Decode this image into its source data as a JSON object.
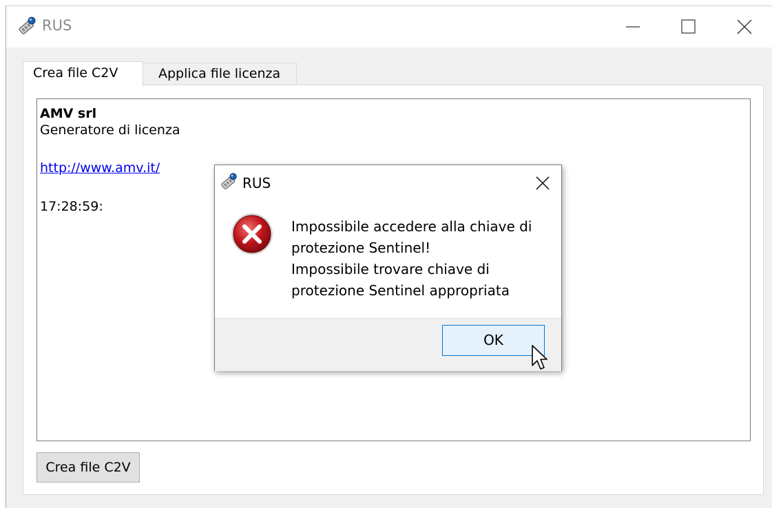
{
  "window": {
    "title": "RUS",
    "controls": {
      "minimize": "minimize-icon",
      "maximize": "maximize-icon",
      "close": "close-icon"
    }
  },
  "tabs": [
    {
      "label": "Crea file C2V",
      "active": true
    },
    {
      "label": "Applica file licenza",
      "active": false
    }
  ],
  "panel": {
    "company": "AMV srl",
    "subtitle": "Generatore di licenza",
    "link": "http://www.amv.it/",
    "time": "17:28:59:"
  },
  "create_button": {
    "label": "Crea file C2V"
  },
  "dialog": {
    "title": "RUS",
    "icon": "error-icon",
    "message_lines": [
      "Impossibile accedere alla chiave di",
      "protezione Sentinel!",
      "Impossibile trovare chiave di",
      "protezione Sentinel appropriata"
    ],
    "ok_label": "OK"
  },
  "colors": {
    "link": "#0000ee",
    "ok_border": "#0078d7",
    "ok_fill": "#e5f1fb",
    "error_red": "#c0151b"
  }
}
